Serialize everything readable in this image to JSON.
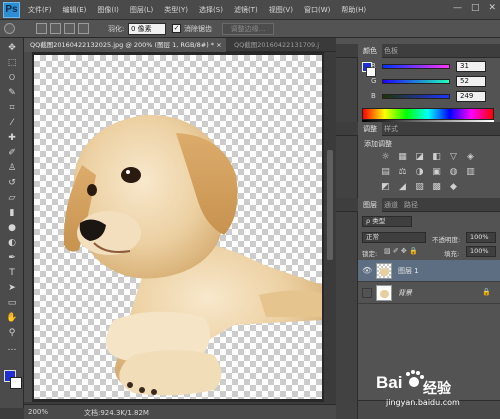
{
  "app": {
    "logo": "Ps"
  },
  "menu": [
    "文件(F)",
    "编辑(E)",
    "图像(I)",
    "图层(L)",
    "类型(Y)",
    "选择(S)",
    "滤镜(T)",
    "视图(V)",
    "窗口(W)",
    "帮助(H)"
  ],
  "window_controls": [
    "—",
    "□",
    "✕"
  ],
  "options": {
    "feather_label": "羽化:",
    "feather_value": "0 像素",
    "antialias_label": "消除锯齿",
    "antialias_checked": true,
    "refine_edge_label": "调整边缘..."
  },
  "tabs": {
    "active": "QQ截图20160422132025.jpg @ 200% (图层 1, RGB/8#) * ×",
    "inactive": "QQ截图20160422131709.j"
  },
  "tools": [
    {
      "icon": "move-tool-icon",
      "glyph": "✥"
    },
    {
      "icon": "marquee-tool-icon",
      "glyph": "⬚"
    },
    {
      "icon": "lasso-tool-icon",
      "glyph": "ଠ"
    },
    {
      "icon": "quick-select-tool-icon",
      "glyph": "✎"
    },
    {
      "icon": "crop-tool-icon",
      "glyph": "⌗"
    },
    {
      "icon": "eyedropper-tool-icon",
      "glyph": "⁄"
    },
    {
      "icon": "healing-brush-tool-icon",
      "glyph": "✚"
    },
    {
      "icon": "brush-tool-icon",
      "glyph": "✐"
    },
    {
      "icon": "clone-stamp-tool-icon",
      "glyph": "♙"
    },
    {
      "icon": "history-brush-tool-icon",
      "glyph": "↺"
    },
    {
      "icon": "eraser-tool-icon",
      "glyph": "▱"
    },
    {
      "icon": "gradient-tool-icon",
      "glyph": "▮"
    },
    {
      "icon": "blur-tool-icon",
      "glyph": "●"
    },
    {
      "icon": "dodge-tool-icon",
      "glyph": "◐"
    },
    {
      "icon": "pen-tool-icon",
      "glyph": "✒"
    },
    {
      "icon": "type-tool-icon",
      "glyph": "T"
    },
    {
      "icon": "path-select-tool-icon",
      "glyph": "➤"
    },
    {
      "icon": "shape-tool-icon",
      "glyph": "▭"
    },
    {
      "icon": "hand-tool-icon",
      "glyph": "✋"
    },
    {
      "icon": "zoom-tool-icon",
      "glyph": "⚲"
    },
    {
      "icon": "more-tools-icon",
      "glyph": "…"
    }
  ],
  "colors": {
    "foreground": "#1f2fd4",
    "background": "#ffffff"
  },
  "status": {
    "zoom": "200%",
    "doc": "文档:924.3K/1.82M"
  },
  "color_panel": {
    "tabs": [
      "颜色",
      "色板"
    ],
    "channels": [
      {
        "label": "R",
        "value": "31"
      },
      {
        "label": "G",
        "value": "52"
      },
      {
        "label": "B",
        "value": "249"
      }
    ]
  },
  "adjustments_panel": {
    "tabs": [
      "调整",
      "样式"
    ],
    "title": "添加调整"
  },
  "layers_panel": {
    "tabs": [
      "图层",
      "通道",
      "路径"
    ],
    "filter_kind": "ρ 类型",
    "blend_mode": "正常",
    "opacity_label": "不透明度:",
    "opacity_value": "100%",
    "lock_label": "锁定:",
    "fill_label": "填充:",
    "fill_value": "100%",
    "layers": [
      {
        "name": "图层 1",
        "visible": true,
        "selected": true
      },
      {
        "name": "背景",
        "visible": false,
        "selected": false,
        "locked": true
      }
    ]
  },
  "watermark": {
    "brand": "经验",
    "url": "jingyan.baidu.com"
  }
}
